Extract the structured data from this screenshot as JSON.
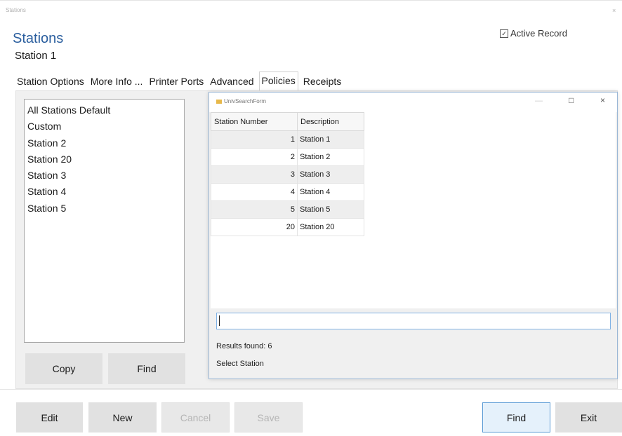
{
  "window": {
    "title": "Stations",
    "close_glyph": "×"
  },
  "header": {
    "title": "Stations",
    "record_name": "Station 1",
    "active_record": {
      "label": "Active Record",
      "checked": true,
      "check_glyph": "☑"
    }
  },
  "tabs": [
    {
      "label": "Station Options"
    },
    {
      "label": "More Info ..."
    },
    {
      "label": "Printer Ports"
    },
    {
      "label": "Advanced"
    },
    {
      "label": "Policies",
      "active": true
    },
    {
      "label": "Receipts"
    }
  ],
  "policies_list": [
    "All Stations Default",
    "Custom",
    "Station 2",
    "Station 20",
    "Station 3",
    "Station 4",
    "Station 5"
  ],
  "panel_buttons": {
    "copy": "Copy",
    "find": "Find"
  },
  "search_form": {
    "title": "UnivSearchForm",
    "minimize_glyph": "—",
    "maximize_glyph": "□",
    "close_glyph": "×",
    "columns": [
      "Station Number",
      "Description"
    ],
    "rows": [
      {
        "number": "1",
        "description": "Station 1"
      },
      {
        "number": "2",
        "description": "Station 2"
      },
      {
        "number": "3",
        "description": "Station 3"
      },
      {
        "number": "4",
        "description": "Station 4"
      },
      {
        "number": "5",
        "description": "Station 5"
      },
      {
        "number": "20",
        "description": "Station 20"
      }
    ],
    "search_value": "",
    "results_text": "Results found: 6",
    "prompt_text": "Select Station"
  },
  "bottom_buttons": {
    "edit": "Edit",
    "new": "New",
    "cancel": "Cancel",
    "save": "Save",
    "find": "Find",
    "exit": "Exit"
  },
  "colors": {
    "title_blue": "#2a5e9e",
    "focus_border": "#5b9bd5",
    "disabled_text": "#b5b5b5"
  }
}
